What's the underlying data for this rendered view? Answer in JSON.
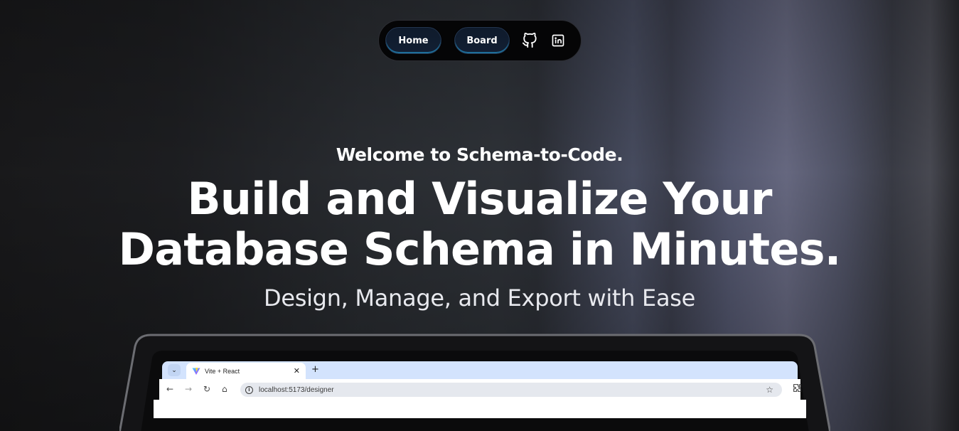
{
  "nav": {
    "home_label": "Home",
    "board_label": "Board",
    "github_icon": "github-icon",
    "linkedin_icon": "linkedin-icon"
  },
  "hero": {
    "welcome": "Welcome to Schema-to-Code.",
    "title_line1": "Build and Visualize Your",
    "title_line2": "Database Schema in Minutes.",
    "tagline": "Design, Manage, and Export with Ease"
  },
  "browser": {
    "tab_title": "Vite + React",
    "tab_close": "✕",
    "new_tab": "+",
    "url": "localhost:5173/designer",
    "back": "←",
    "forward": "→",
    "reload": "↻",
    "home": "⌂",
    "star": "☆",
    "menu_chevron": "⌄"
  },
  "colors": {
    "accent": "#1e6f9a",
    "nav_bg": "#050506",
    "tab_strip": "#d3e3fd"
  }
}
